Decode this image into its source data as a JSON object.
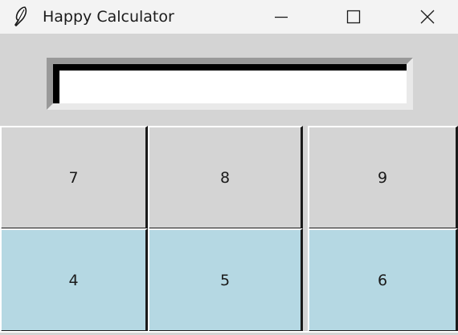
{
  "window": {
    "title": "Happy Calculator",
    "icon": "feather-icon",
    "controls": [
      "minimize-icon",
      "maximize-icon",
      "close-icon"
    ]
  },
  "display": {
    "value": ""
  },
  "buttons": {
    "row1": [
      "7",
      "8",
      "9"
    ],
    "row2": [
      "4",
      "5",
      "6"
    ]
  },
  "colors": {
    "row1_bg": "#d4d4d4",
    "row2_bg": "#b5d8e3"
  }
}
